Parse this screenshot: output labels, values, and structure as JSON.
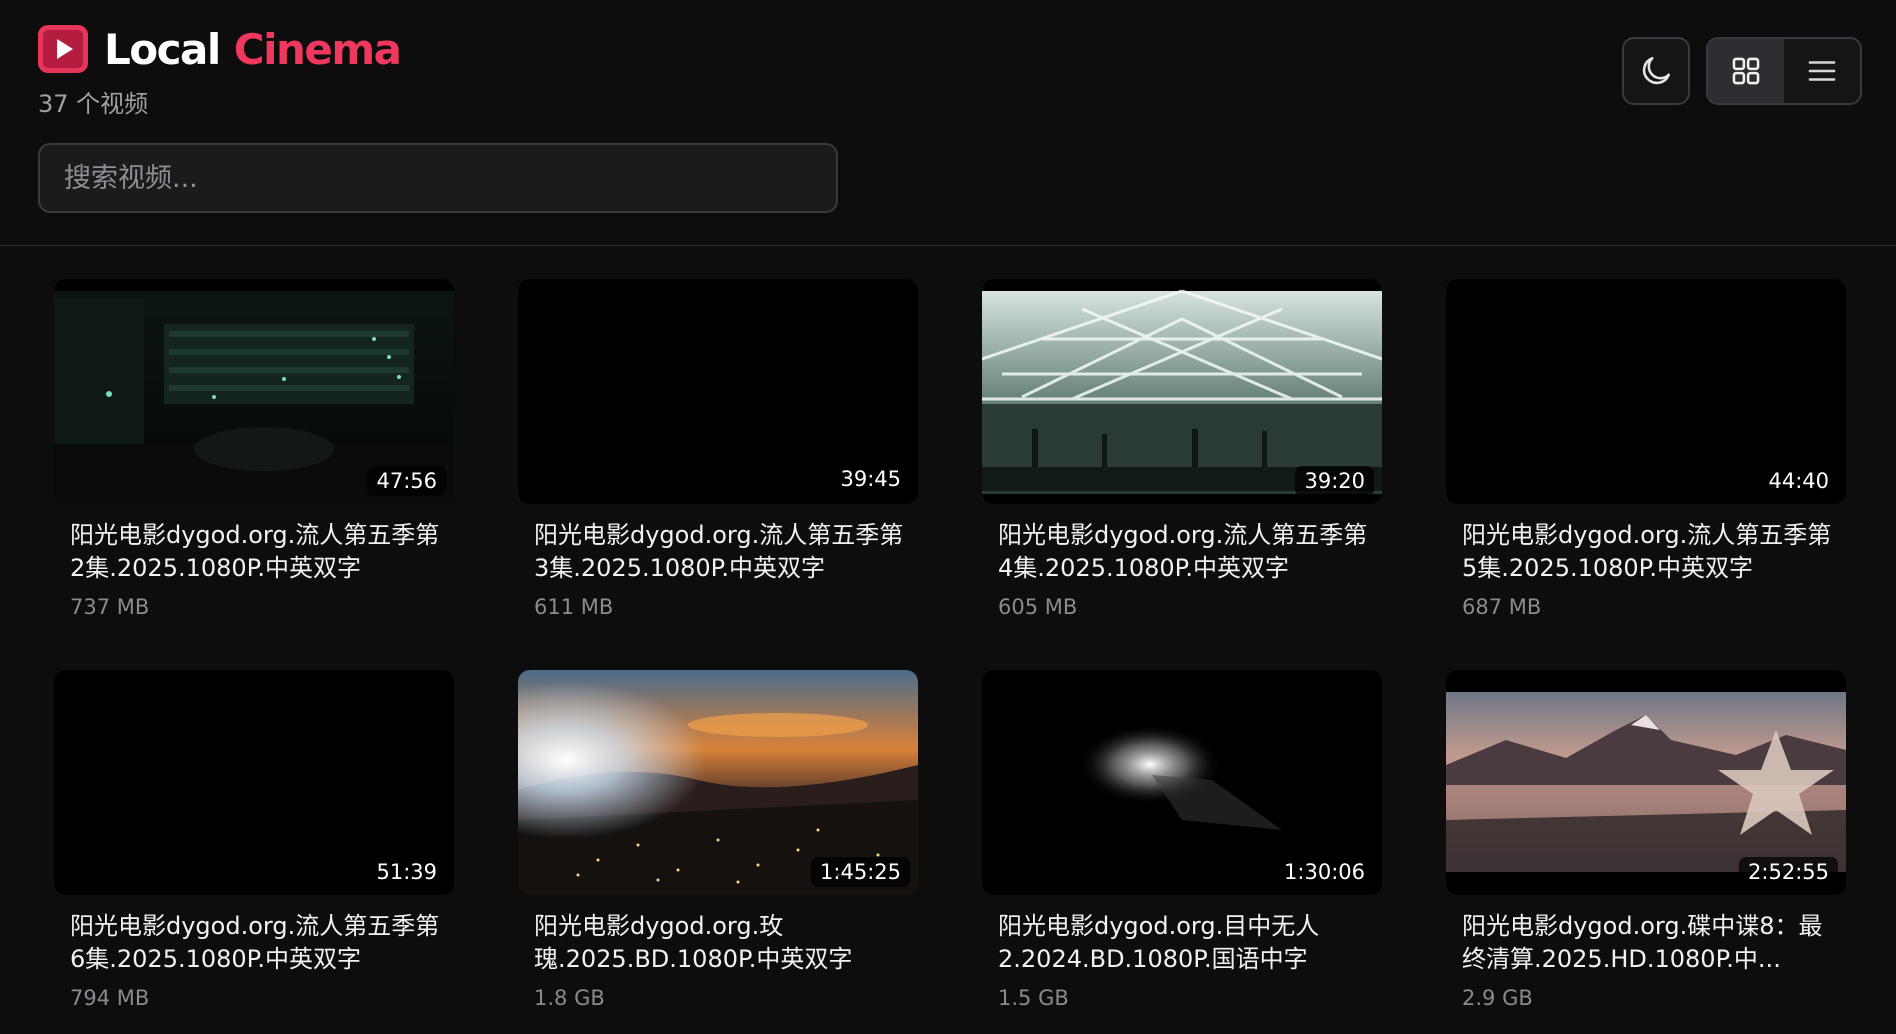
{
  "app": {
    "title_part1": "Local",
    "title_part2": "Cinema",
    "video_count": "37 个视频"
  },
  "search": {
    "placeholder": "搜索视频..."
  },
  "toolbar": {
    "theme_icon": "moon-icon",
    "view_mode": "grid",
    "grid_icon": "grid-icon",
    "list_icon": "list-icon"
  },
  "colors": {
    "accent": "#f0385f",
    "background": "#0d0d0e"
  },
  "videos": [
    {
      "title": "阳光电影dygod.org.流人第五季第2集.2025.1080P.中英双字",
      "size": "737 MB",
      "duration": "47:56"
    },
    {
      "title": "阳光电影dygod.org.流人第五季第3集.2025.1080P.中英双字",
      "size": "611 MB",
      "duration": "39:45"
    },
    {
      "title": "阳光电影dygod.org.流人第五季第4集.2025.1080P.中英双字",
      "size": "605 MB",
      "duration": "39:20"
    },
    {
      "title": "阳光电影dygod.org.流人第五季第5集.2025.1080P.中英双字",
      "size": "687 MB",
      "duration": "44:40"
    },
    {
      "title": "阳光电影dygod.org.流人第五季第6集.2025.1080P.中英双字",
      "size": "794 MB",
      "duration": "51:39"
    },
    {
      "title": "阳光电影dygod.org.玫瑰.2025.BD.1080P.中英双字",
      "size": "1.8 GB",
      "duration": "1:45:25"
    },
    {
      "title": "阳光电影dygod.org.目中无人2.2024.BD.1080P.国语中字",
      "size": "1.5 GB",
      "duration": "1:30:06"
    },
    {
      "title": "阳光电影dygod.org.碟中谍8：最终清算.2025.HD.1080P.中...",
      "size": "2.9 GB",
      "duration": "2:52:55"
    }
  ]
}
